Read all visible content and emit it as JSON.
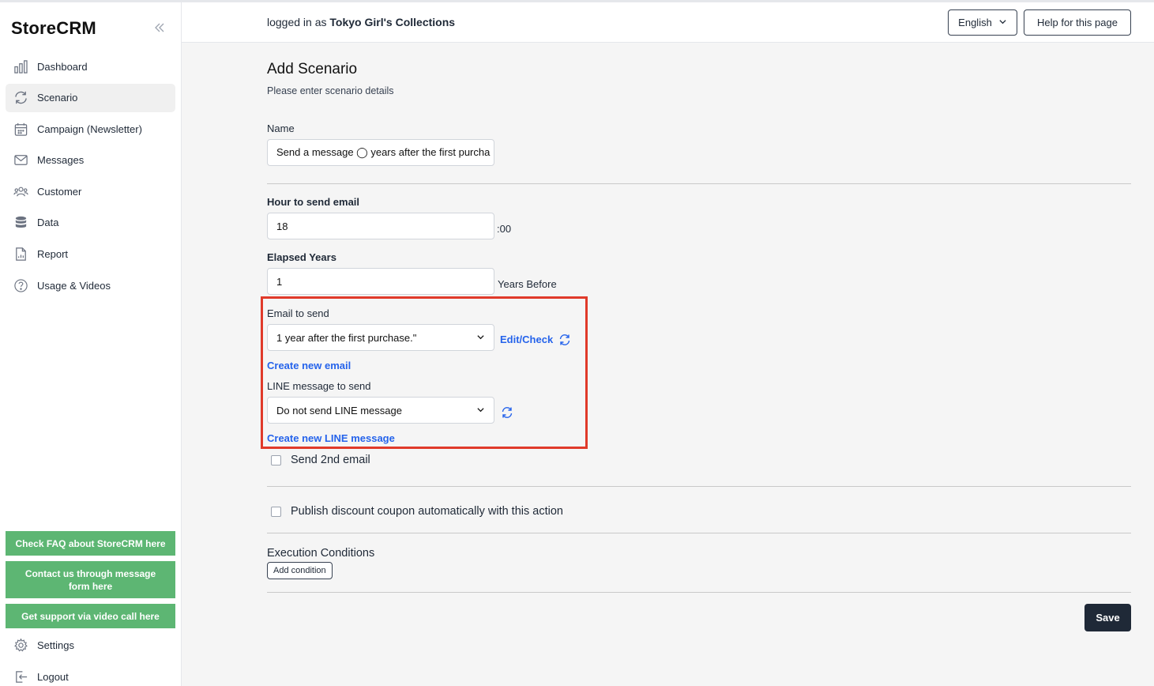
{
  "app": {
    "name": "StoreCRM"
  },
  "sidebar": {
    "items": [
      {
        "label": "Dashboard",
        "icon": "bar-chart-icon"
      },
      {
        "label": "Scenario",
        "icon": "refresh-icon",
        "active": true
      },
      {
        "label": "Campaign (Newsletter)",
        "icon": "calendar-icon"
      },
      {
        "label": "Messages",
        "icon": "mail-icon"
      },
      {
        "label": "Customer",
        "icon": "users-icon"
      },
      {
        "label": "Data",
        "icon": "database-icon"
      },
      {
        "label": "Report",
        "icon": "document-icon"
      },
      {
        "label": "Usage & Videos",
        "icon": "question-icon"
      }
    ],
    "help_buttons": [
      "Check FAQ about StoreCRM here",
      "Contact us through message form here",
      "Get support via video call here"
    ],
    "settings_label": "Settings",
    "logout_label": "Logout",
    "help_button_color": "#5db673"
  },
  "topbar": {
    "logged_prefix": "logged in as",
    "user_name": "Tokyo Girl's Collections",
    "language": "English",
    "help_label": "Help for this page"
  },
  "form": {
    "title": "Add Scenario",
    "subtitle": "Please enter scenario details",
    "name_label": "Name",
    "name_value": "Send a message ◯ years after the first purcha",
    "hour_label": "Hour to send email",
    "hour_value": "18",
    "hour_suffix": ":00",
    "elapsed_label": "Elapsed Years",
    "elapsed_value": "1",
    "elapsed_suffix": "Years Before",
    "email_label": "Email to send",
    "email_selected": "1 year after the first purchase.\"",
    "edit_check": "Edit/Check",
    "create_email": "Create new email",
    "line_label": "LINE message to send",
    "line_selected": "Do not send LINE message",
    "create_line": "Create new LINE message",
    "second_email": "Send 2nd email",
    "coupon": "Publish discount coupon automatically with this action",
    "conditions_title": "Execution Conditions",
    "add_condition": "Add condition",
    "save": "Save",
    "highlight_color": "#e03a2a",
    "link_color": "#2563eb"
  }
}
